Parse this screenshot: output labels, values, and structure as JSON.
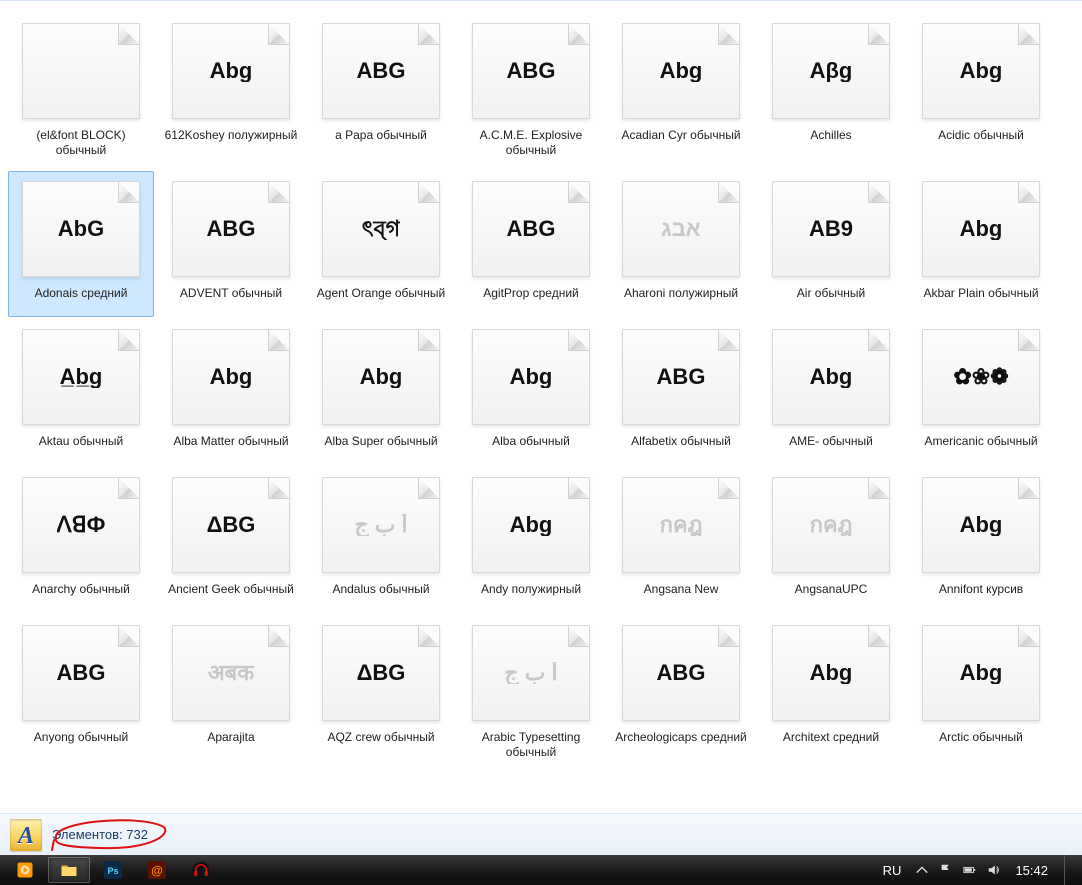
{
  "details": {
    "label_text": "Элементов: 732"
  },
  "taskbar": {
    "language": "RU",
    "clock": "15:42"
  },
  "items": [
    {
      "label": "(el&font BLOCK) обычный",
      "preview": "",
      "stack": false,
      "light": false,
      "selected": false,
      "blank": true
    },
    {
      "label": "612Koshey полужирный",
      "preview": "Abg",
      "stack": false,
      "light": false,
      "selected": false
    },
    {
      "label": "a Papa обычный",
      "preview": "ABG",
      "stack": false,
      "light": false,
      "selected": false
    },
    {
      "label": "A.C.M.E. Explosive обычный",
      "preview": "ABG",
      "stack": false,
      "light": false,
      "selected": false
    },
    {
      "label": "Acadian Cyr обычный",
      "preview": "Abg",
      "stack": false,
      "light": false,
      "selected": false
    },
    {
      "label": "Achilles",
      "preview": "Αβg",
      "stack": true,
      "light": false,
      "selected": false
    },
    {
      "label": "Acidic обычный",
      "preview": "Abg",
      "stack": false,
      "light": false,
      "selected": false
    },
    {
      "label": "Adonais средний",
      "preview": "AbG",
      "stack": false,
      "light": false,
      "selected": true
    },
    {
      "label": "ADVENT обычный",
      "preview": "ABG",
      "stack": false,
      "light": false,
      "selected": false
    },
    {
      "label": "Agent Orange обычный",
      "preview": "ৎব্গ",
      "stack": false,
      "light": false,
      "selected": false
    },
    {
      "label": "AgitProp средний",
      "preview": "ABG",
      "stack": false,
      "light": false,
      "selected": false
    },
    {
      "label": "Aharoni полужирный",
      "preview": "אבג",
      "stack": false,
      "light": true,
      "selected": false
    },
    {
      "label": "Air обычный",
      "preview": "AB9",
      "stack": false,
      "light": false,
      "selected": false
    },
    {
      "label": "Akbar Plain обычный",
      "preview": "Abg",
      "stack": false,
      "light": false,
      "selected": false
    },
    {
      "label": "Aktau обычный",
      "preview": "A̲b̲g̲",
      "stack": false,
      "light": false,
      "selected": false
    },
    {
      "label": "Alba Matter обычный",
      "preview": "Abg",
      "stack": false,
      "light": false,
      "selected": false
    },
    {
      "label": "Alba Super обычный",
      "preview": "Abg",
      "stack": false,
      "light": false,
      "selected": false
    },
    {
      "label": "Alba обычный",
      "preview": "Abg",
      "stack": false,
      "light": false,
      "selected": false
    },
    {
      "label": "Alfabetix обычный",
      "preview": "ABG",
      "stack": false,
      "light": false,
      "selected": false
    },
    {
      "label": "AME- обычный",
      "preview": "Abg",
      "stack": false,
      "light": false,
      "selected": false
    },
    {
      "label": "Americanic обычный",
      "preview": "✿❀❁",
      "stack": false,
      "light": false,
      "selected": false
    },
    {
      "label": "Anarchy обычный",
      "preview": "ꓥꓭФ",
      "stack": false,
      "light": false,
      "selected": false
    },
    {
      "label": "Ancient Geek обычный",
      "preview": "ΔBG",
      "stack": false,
      "light": false,
      "selected": false
    },
    {
      "label": "Andalus обычный",
      "preview": "أ ب ج",
      "stack": false,
      "light": true,
      "selected": false
    },
    {
      "label": "Andy полужирный",
      "preview": "Abg",
      "stack": false,
      "light": false,
      "selected": false
    },
    {
      "label": "Angsana New",
      "preview": "กคฎ",
      "stack": true,
      "light": true,
      "selected": false
    },
    {
      "label": "AngsanaUPC",
      "preview": "กคฎ",
      "stack": true,
      "light": true,
      "selected": false
    },
    {
      "label": "Annifont курсив",
      "preview": "Abg",
      "stack": false,
      "light": false,
      "selected": false
    },
    {
      "label": "Anyong обычный",
      "preview": "ABG",
      "stack": false,
      "light": false,
      "selected": false
    },
    {
      "label": "Aparajita",
      "preview": "अबक",
      "stack": true,
      "light": true,
      "selected": false
    },
    {
      "label": "AQZ crew обычный",
      "preview": "ΔBG",
      "stack": false,
      "light": false,
      "selected": false
    },
    {
      "label": "Arabic Typesetting обычный",
      "preview": "أ ب ج",
      "stack": false,
      "light": true,
      "selected": false
    },
    {
      "label": "Archeologicaps средний",
      "preview": "ABG",
      "stack": false,
      "light": false,
      "selected": false
    },
    {
      "label": "Architext средний",
      "preview": "Abg",
      "stack": false,
      "light": false,
      "selected": false
    },
    {
      "label": "Arctic обычный",
      "preview": "Abg",
      "stack": false,
      "light": false,
      "selected": false
    }
  ]
}
